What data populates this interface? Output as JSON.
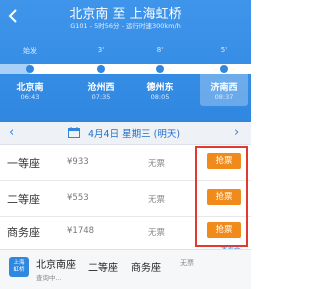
{
  "header": {
    "title": "北京南 至 上海虹桥",
    "subtitle": "G101 - 5时56分 - 运行时速300km/h"
  },
  "route": {
    "stations": [
      {
        "tag": "始发",
        "name": "北京南",
        "time": "06:43"
      },
      {
        "tag": "3'",
        "name": "沧州西",
        "time": "07:35"
      },
      {
        "tag": "8'",
        "name": "德州东",
        "time": "08:05"
      },
      {
        "tag": "5'",
        "name": "济南西",
        "time": "08:37"
      }
    ]
  },
  "datebar": {
    "date_text": "4月4日 星期三 (明天)"
  },
  "seats": [
    {
      "name": "一等座",
      "price": "¥933",
      "availability": "无票",
      "action": "抢票"
    },
    {
      "name": "二等座",
      "price": "¥553",
      "availability": "无票",
      "action": "抢票"
    },
    {
      "name": "商务座",
      "price": "¥1748",
      "availability": "无票",
      "action": "抢票"
    }
  ],
  "more_label": "查看余",
  "bottom_bar": {
    "logo_text_line1": "上海",
    "logo_text_line2": "虹桥",
    "station": "北京南座",
    "sub": "查询中...",
    "seat1": "二等座",
    "seat2": "商务座",
    "availability": "无票"
  },
  "icons": {
    "back": "back-arrow-icon",
    "prev": "chevron-left-icon",
    "next": "chevron-right-icon",
    "calendar": "calendar-icon"
  },
  "colors": {
    "header_blue": "#2f87e0",
    "grab_orange": "#f08a1a",
    "highlight_red": "#e23a2e"
  }
}
